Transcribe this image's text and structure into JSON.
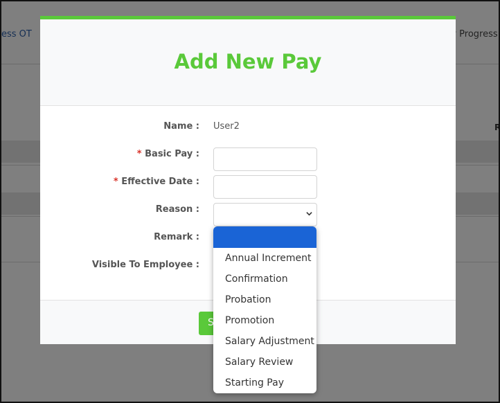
{
  "background": {
    "left_tab": "ess OT",
    "right_tab": "ry Progress",
    "right_label": "R"
  },
  "modal": {
    "title": "Add New Pay",
    "accent_color": "#5ac93a",
    "fields": {
      "name_label": "Name :",
      "name_value": "User2",
      "basic_pay_label": "Basic Pay :",
      "effective_date_label": "Effective Date :",
      "reason_label": "Reason :",
      "remark_label": "Remark :",
      "visible_label": "Visible To Employee :",
      "required_marker": "*"
    },
    "footer": {
      "submit_label": "Submit"
    }
  },
  "reason_dropdown": {
    "selected": "",
    "options": [
      "",
      "Annual Increment",
      "Confirmation",
      "Probation",
      "Promotion",
      "Salary Adjustment",
      "Salary Review",
      "Starting Pay"
    ],
    "highlight_color": "#1a64d6"
  }
}
